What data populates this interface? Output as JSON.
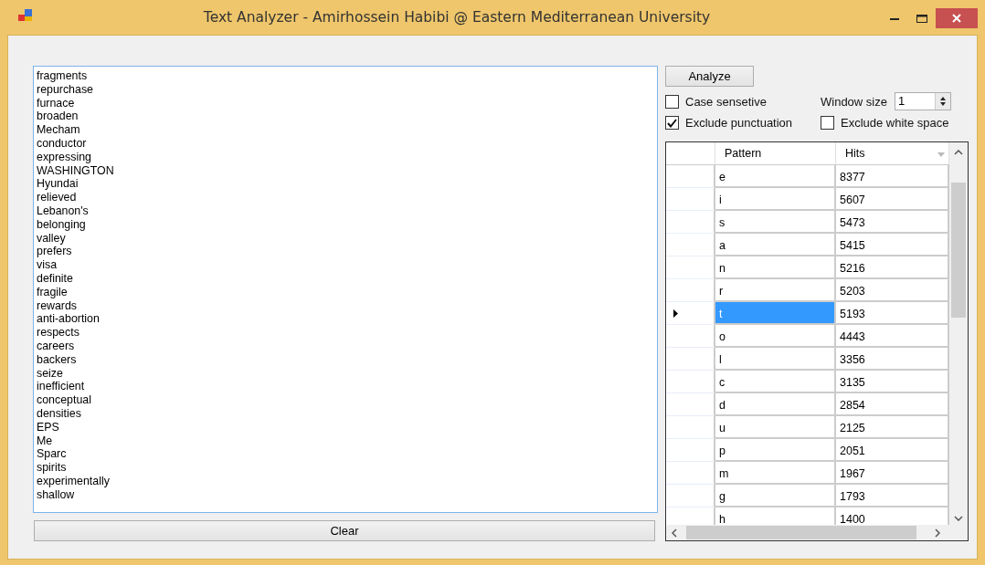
{
  "window": {
    "title": "Text Analyzer - Amirhossein Habibi @ Eastern Mediterranean University"
  },
  "text_area": {
    "lines": [
      "fragments",
      "repurchase",
      "furnace",
      "broaden",
      "Mecham",
      "conductor",
      "expressing",
      "WASHINGTON",
      "Hyundai",
      "relieved",
      "Lebanon's",
      "belonging",
      "valley",
      "prefers",
      "visa",
      "definite",
      "fragile",
      "rewards",
      "anti-abortion",
      "respects",
      "careers",
      "backers",
      "seize",
      "inefficient",
      "conceptual",
      "densities",
      "EPS",
      "Me",
      "Sparc",
      "spirits",
      "experimentally",
      "shallow"
    ]
  },
  "analyze_button": "Analyze",
  "clear_button": "Clear",
  "options": [
    {
      "label": "Case sensetive",
      "checked": false
    },
    {
      "label": "Exclude punctuation",
      "checked": true
    },
    {
      "label": "Exclude white space",
      "checked": false
    }
  ],
  "window_size": {
    "label": "Window size",
    "value": "1"
  },
  "grid": {
    "columns": [
      "Pattern",
      "Hits"
    ],
    "rows": [
      {
        "pattern": "e",
        "hits": "8377",
        "selected": false
      },
      {
        "pattern": "i",
        "hits": "5607",
        "selected": false
      },
      {
        "pattern": "s",
        "hits": "5473",
        "selected": false
      },
      {
        "pattern": "a",
        "hits": "5415",
        "selected": false
      },
      {
        "pattern": "n",
        "hits": "5216",
        "selected": false
      },
      {
        "pattern": "r",
        "hits": "5203",
        "selected": false
      },
      {
        "pattern": "t",
        "hits": "5193",
        "selected": true
      },
      {
        "pattern": "o",
        "hits": "4443",
        "selected": false
      },
      {
        "pattern": "l",
        "hits": "3356",
        "selected": false
      },
      {
        "pattern": "c",
        "hits": "3135",
        "selected": false
      },
      {
        "pattern": "d",
        "hits": "2854",
        "selected": false
      },
      {
        "pattern": "u",
        "hits": "2125",
        "selected": false
      },
      {
        "pattern": "p",
        "hits": "2051",
        "selected": false
      },
      {
        "pattern": "m",
        "hits": "1967",
        "selected": false
      },
      {
        "pattern": "g",
        "hits": "1793",
        "selected": false
      },
      {
        "pattern": "h",
        "hits": "1400",
        "selected": false
      }
    ]
  }
}
